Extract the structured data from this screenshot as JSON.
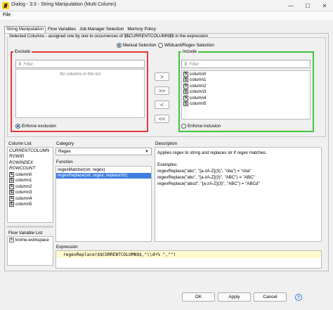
{
  "window": {
    "title": "Dialog - 3:3 - String Manipulation (Multi Column)",
    "minimize": "—",
    "maximize": "☐",
    "close": "✕"
  },
  "menu": {
    "file": "File"
  },
  "tabs": [
    {
      "label": "String Manipulation",
      "active": true
    },
    {
      "label": "Flow Variables",
      "active": false
    },
    {
      "label": "Job Manager Selection",
      "active": false
    },
    {
      "label": "Memory Policy",
      "active": false
    }
  ],
  "selected_columns": {
    "title": "Selected Columns - assigned one by one to occurrences of $$CURRENTCOLUMN$$ in the expression",
    "manual_selection": "Manual Selection",
    "wildcard_selection": "Wildcard/Regex Selection",
    "mode": "manual"
  },
  "exclude": {
    "title": "Exclude",
    "filter_placeholder": "Filter",
    "empty_text": "No columns in this list",
    "enforce_label": "Enforce exclusion",
    "enforce_selected": true
  },
  "include": {
    "title": "Include",
    "filter_placeholder": "Filter",
    "columns": [
      "column0",
      "column1",
      "column2",
      "column3",
      "column4",
      "column5"
    ],
    "enforce_label": "Enforce inclusion",
    "enforce_selected": false
  },
  "arrow_buttons": {
    "add": ">",
    "add_all": ">>",
    "remove": "<",
    "remove_all": "<<"
  },
  "column_list": {
    "title": "Column List",
    "special": [
      "CURRENTCOLUMN",
      "ROWID",
      "ROWINDEX",
      "ROWCOUNT"
    ],
    "columns": [
      "column0",
      "column1",
      "column2",
      "column3",
      "column4",
      "column5"
    ]
  },
  "flow_variable_list": {
    "title": "Flow Variable List",
    "items": [
      "knime.workspace"
    ]
  },
  "category": {
    "title": "Category",
    "selected": "Regex"
  },
  "function": {
    "title": "Function",
    "items": [
      "regexMatcher(str, regex)",
      "regexReplace(str, regex, replaceStr)"
    ],
    "selected_index": 1
  },
  "description": {
    "title": "Description",
    "summary": "Applies regex to string and replaces str if regex matches.",
    "examples_label": "Examples:",
    "examples": [
      "regexReplace(\"abc\", \"[a-zA-Z](3)\", \"cba\")      = \"cba\"",
      "regexReplace(\"abc\", \"[a-zA-Z](3)\", \"ABC\")      = \"ABC\"",
      "regexReplace(\"abcd\", \"[a-zA-Z](3)\", \"ABC\")     = \"ABCd\""
    ]
  },
  "expression": {
    "title": "Expression",
    "value": "regexReplace($$CURRENTCOLUMN$$,\"\\\\d+% \",\"\")"
  },
  "footer": {
    "ok": "OK",
    "apply": "Apply",
    "cancel": "Cancel",
    "help": "?"
  },
  "colors": {
    "exclude_border": "#e23a3a",
    "include_border": "#3ec63e",
    "selection": "#3d7ee0",
    "expression_bg": "#fffacd"
  }
}
